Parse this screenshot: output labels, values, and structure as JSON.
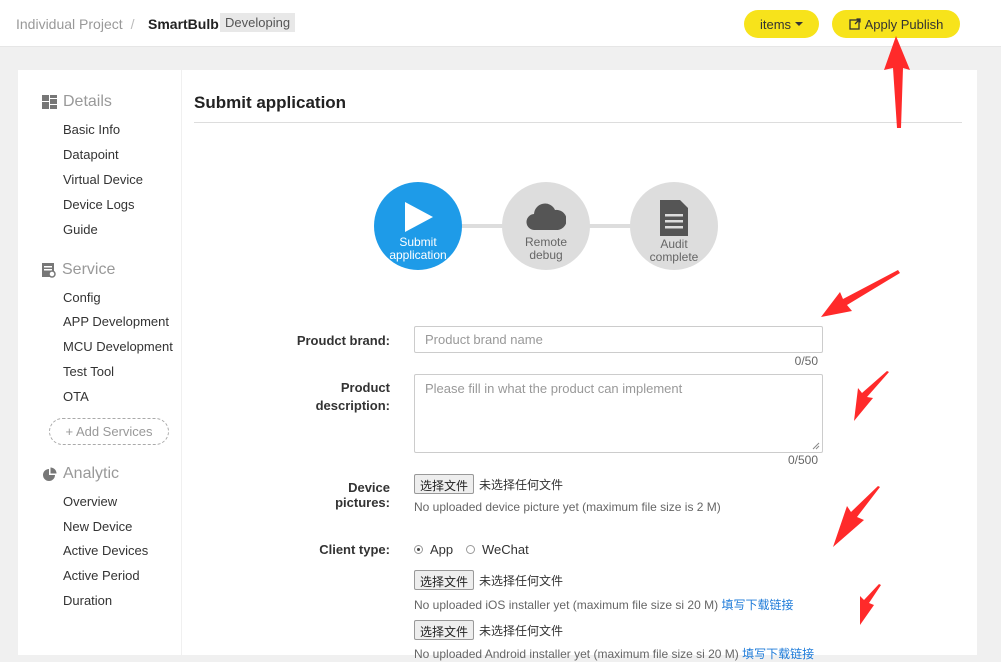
{
  "header": {
    "breadcrumb": "Individual Project",
    "separator": "/",
    "project_name": "SmartBulb",
    "status_badge": "Developing",
    "items_button": "items",
    "apply_publish_button": "Apply Publish"
  },
  "sidebar": {
    "sections": [
      {
        "label": "Details",
        "icon": "grid-icon",
        "items": [
          "Basic Info",
          "Datapoint",
          "Virtual Device",
          "Device Logs",
          "Guide"
        ]
      },
      {
        "label": "Service",
        "icon": "service-icon",
        "items": [
          "Config",
          "APP Development",
          "MCU Development",
          "Test Tool",
          "OTA"
        ]
      },
      {
        "label": "Analytic",
        "icon": "pie-chart-icon",
        "items": [
          "Overview",
          "New Device",
          "Active Devices",
          "Active Period",
          "Duration"
        ]
      }
    ],
    "add_services": "+ Add Services"
  },
  "main": {
    "title": "Submit application",
    "steps": [
      {
        "label_line1": "Submit",
        "label_line2": "application",
        "icon": "play-icon",
        "active": true
      },
      {
        "label_line1": "Remote",
        "label_line2": "debug",
        "icon": "cloud-icon",
        "active": false
      },
      {
        "label_line1": "Audit",
        "label_line2": "complete",
        "icon": "document-icon",
        "active": false
      }
    ],
    "form": {
      "brand_label": "Proudct brand:",
      "brand_placeholder": "Product brand name",
      "brand_counter": "0/50",
      "desc_label_line1": "Product",
      "desc_label_line2": "description:",
      "desc_placeholder": "Please fill in what the product can implement",
      "desc_counter": "0/500",
      "pictures_label": "Device pictures:",
      "choose_file": "选择文件",
      "no_file": "未选择任何文件",
      "pictures_hint": "No uploaded device picture yet (maximum file size is 2 M)",
      "client_type_label": "Client type:",
      "client_options": [
        "App",
        "WeChat"
      ],
      "client_selected": "App",
      "ios_hint": "No uploaded iOS installer yet (maximum file size si 20 M)",
      "android_hint": "No uploaded Android installer yet (maximum file size si 20 M)",
      "download_link": "填写下载链接"
    }
  },
  "colors": {
    "accent_yellow": "#f7e31b",
    "step_active": "#1e9be8",
    "annotation_red": "#ff2a2a"
  }
}
